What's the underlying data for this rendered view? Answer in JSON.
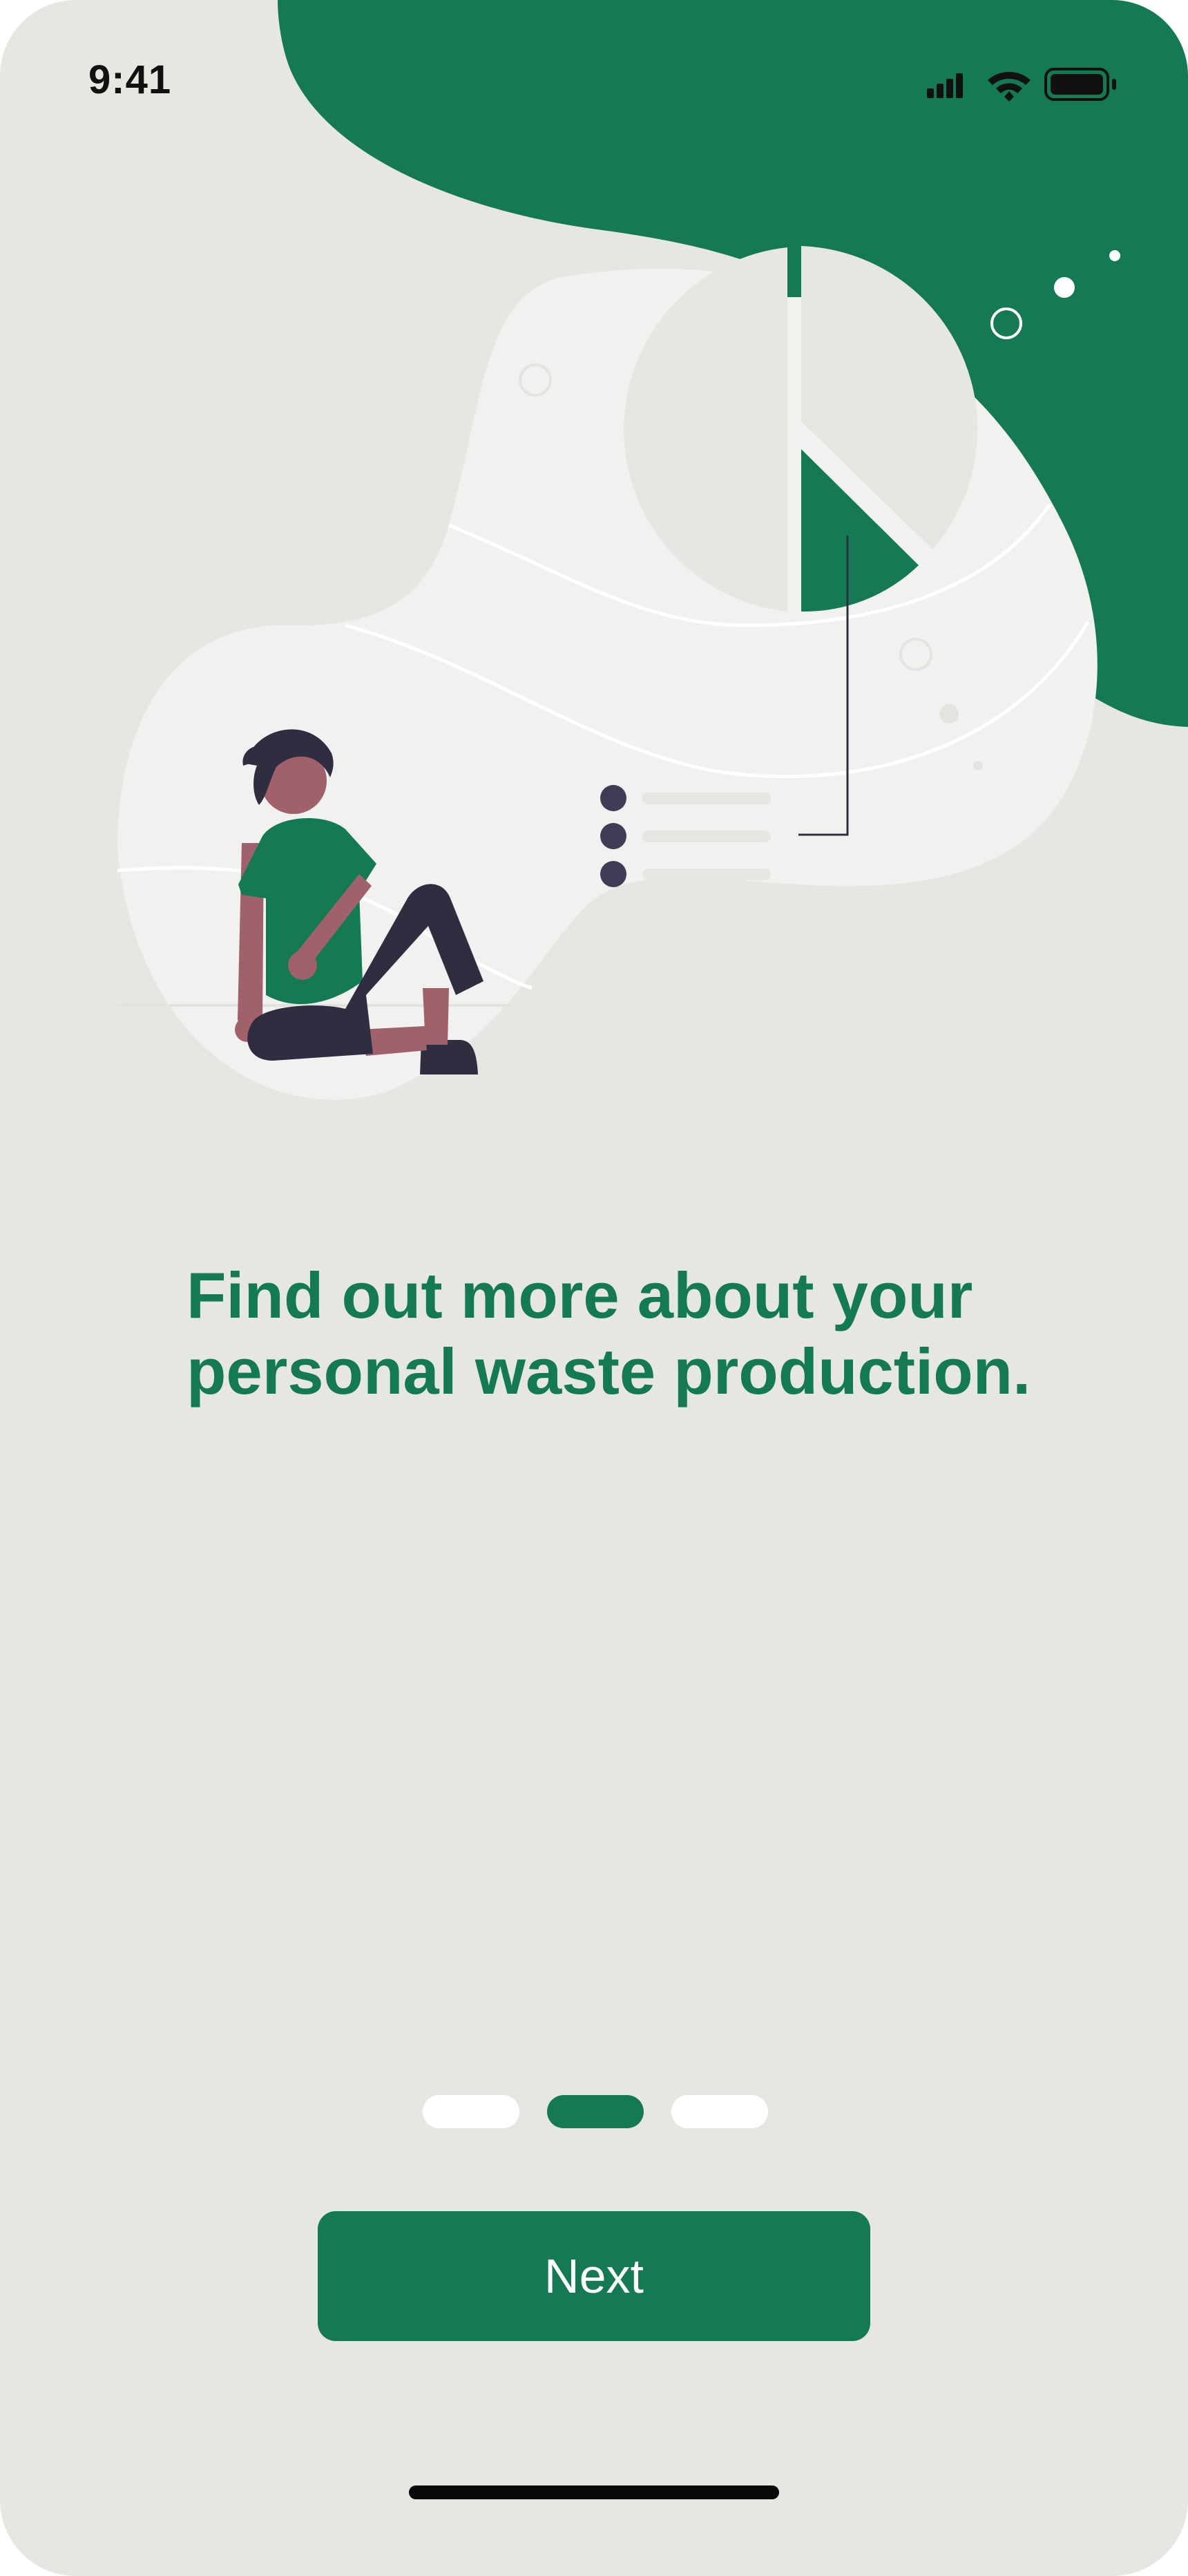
{
  "status_bar": {
    "time": "9:41",
    "icons": [
      "cellular-signal-icon",
      "wifi-icon",
      "battery-icon"
    ]
  },
  "onboarding": {
    "headline": "Find out more about your\npersonal waste production.",
    "pages_total": 3,
    "current_page": 2,
    "next_label": "Next"
  },
  "colors": {
    "brand_green": "#137a52",
    "background": "#e7e7e2",
    "illustration_light": "#f1f1f0",
    "dark_navy": "#2f2e41",
    "skin": "#a0616a"
  }
}
